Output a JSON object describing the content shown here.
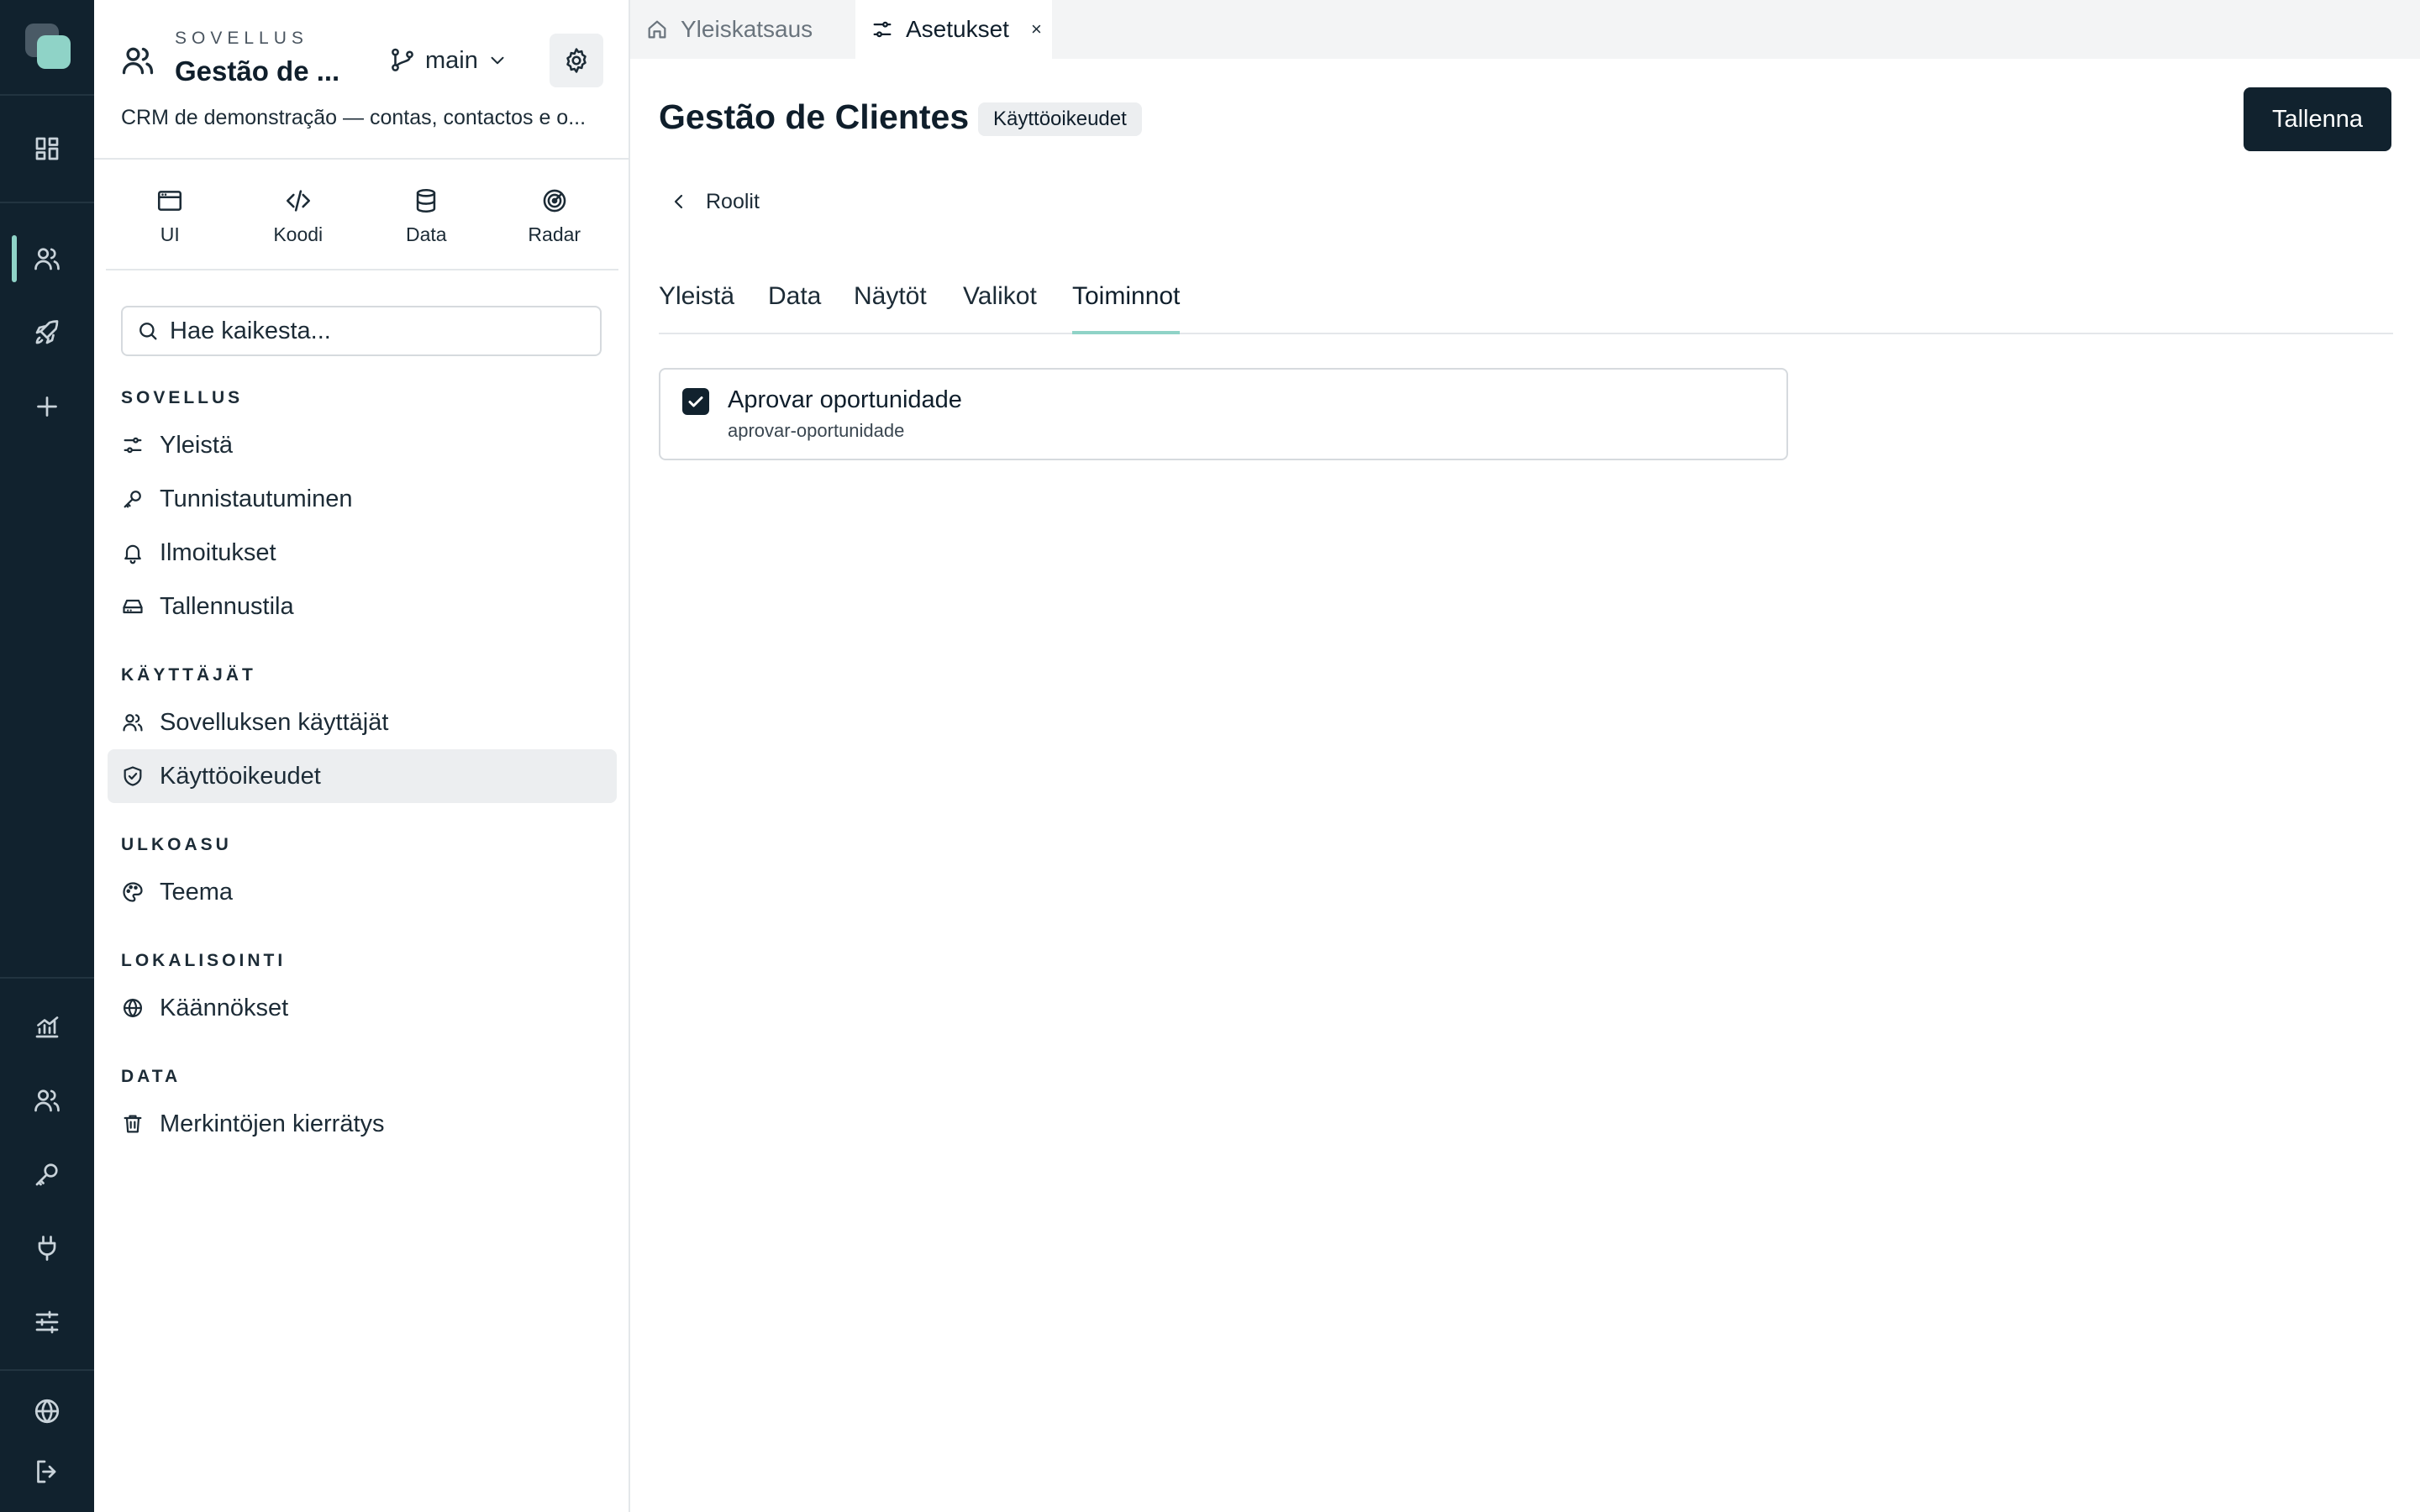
{
  "app": {
    "kicker": "SOVELLUS",
    "name": "Gestão de ...",
    "description": "CRM de demonstração — contas, contactos e o...",
    "branch": "main"
  },
  "modes": [
    {
      "label": "UI",
      "icon": "browser-window-icon"
    },
    {
      "label": "Koodi",
      "icon": "code-icon"
    },
    {
      "label": "Data",
      "icon": "database-icon"
    },
    {
      "label": "Radar",
      "icon": "radar-icon"
    }
  ],
  "search": {
    "placeholder": "Hae kaikesta..."
  },
  "sidebar": {
    "sections": [
      {
        "title": "SOVELLUS",
        "items": [
          {
            "label": "Yleistä",
            "icon": "sliders-icon"
          },
          {
            "label": "Tunnistautuminen",
            "icon": "key-icon"
          },
          {
            "label": "Ilmoitukset",
            "icon": "bell-icon"
          },
          {
            "label": "Tallennustila",
            "icon": "hard-drive-icon"
          }
        ]
      },
      {
        "title": "KÄYTTÄJÄT",
        "items": [
          {
            "label": "Sovelluksen käyttäjät",
            "icon": "users-icon"
          },
          {
            "label": "Käyttöoikeudet",
            "icon": "shield-check-icon",
            "active": true
          }
        ]
      },
      {
        "title": "ULKOASU",
        "items": [
          {
            "label": "Teema",
            "icon": "palette-icon"
          }
        ]
      },
      {
        "title": "LOKALISOINTI",
        "items": [
          {
            "label": "Käännökset",
            "icon": "globe-icon"
          }
        ]
      },
      {
        "title": "DATA",
        "items": [
          {
            "label": "Merkintöjen kierrätys",
            "icon": "trash-icon"
          }
        ]
      }
    ]
  },
  "tabs": [
    {
      "label": "Yleiskatsaus",
      "icon": "home-icon"
    },
    {
      "label": "Asetukset",
      "icon": "sliders-icon",
      "close": "×",
      "active": true
    }
  ],
  "page": {
    "title": "Gestão de Clientes",
    "badge": "Käyttöoikeudet",
    "save_label": "Tallenna",
    "back_label": "Roolit"
  },
  "subtabs": [
    {
      "label": "Yleistä"
    },
    {
      "label": "Data"
    },
    {
      "label": "Näytöt"
    },
    {
      "label": "Valikot"
    },
    {
      "label": "Toiminnot",
      "active": true
    }
  ],
  "permissions": [
    {
      "title": "Aprovar oportunidade",
      "key": "aprovar-oportunidade",
      "checked": true
    }
  ],
  "colors": {
    "rail_bg": "#11222e",
    "accent": "#8fd3c7",
    "primary_button": "#11222e"
  }
}
